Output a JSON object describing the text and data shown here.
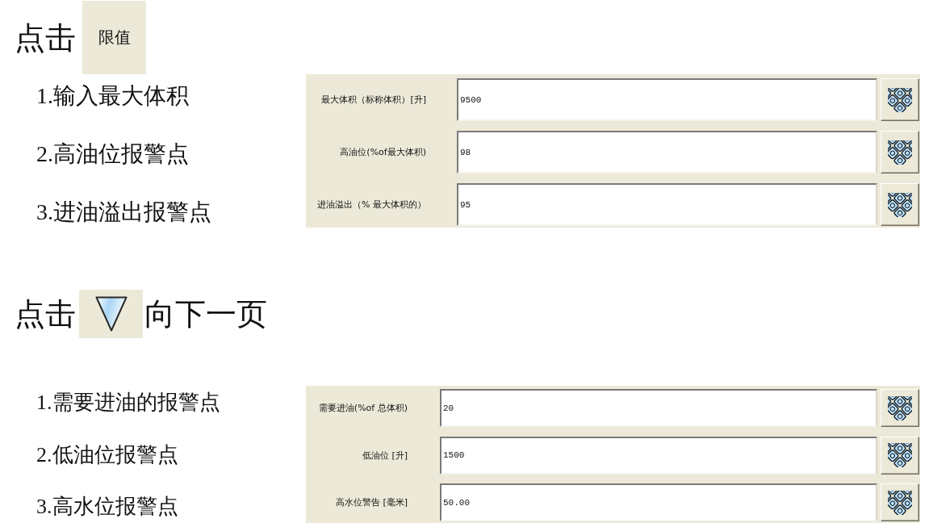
{
  "sections": [
    {
      "heading": {
        "before": "点击",
        "button": {
          "kind": "text",
          "label": "限值"
        }
      },
      "steps": [
        "1.输入最大体积",
        "2.高油位报警点",
        "3.进油溢出报警点"
      ],
      "fields": [
        {
          "label": "最大体积（标称体积）[升]",
          "value": "9500"
        },
        {
          "label": "高油位(%of最大体积)",
          "value": "98"
        },
        {
          "label": "进油溢出（% 最大体积的）",
          "value": "95"
        }
      ]
    },
    {
      "heading": {
        "before": "点击",
        "button": {
          "kind": "icon"
        },
        "after": "向下一页"
      },
      "steps": [
        "1.需要进油的报警点",
        "2.低油位报警点",
        "3.高水位报警点"
      ],
      "fields": [
        {
          "label": "需要进油(%of 总体积)",
          "value": "20"
        },
        {
          "label": "低油位 [升]",
          "value": "1500"
        },
        {
          "label": "高水位警告 [毫米]",
          "value": "50.00"
        }
      ]
    }
  ]
}
